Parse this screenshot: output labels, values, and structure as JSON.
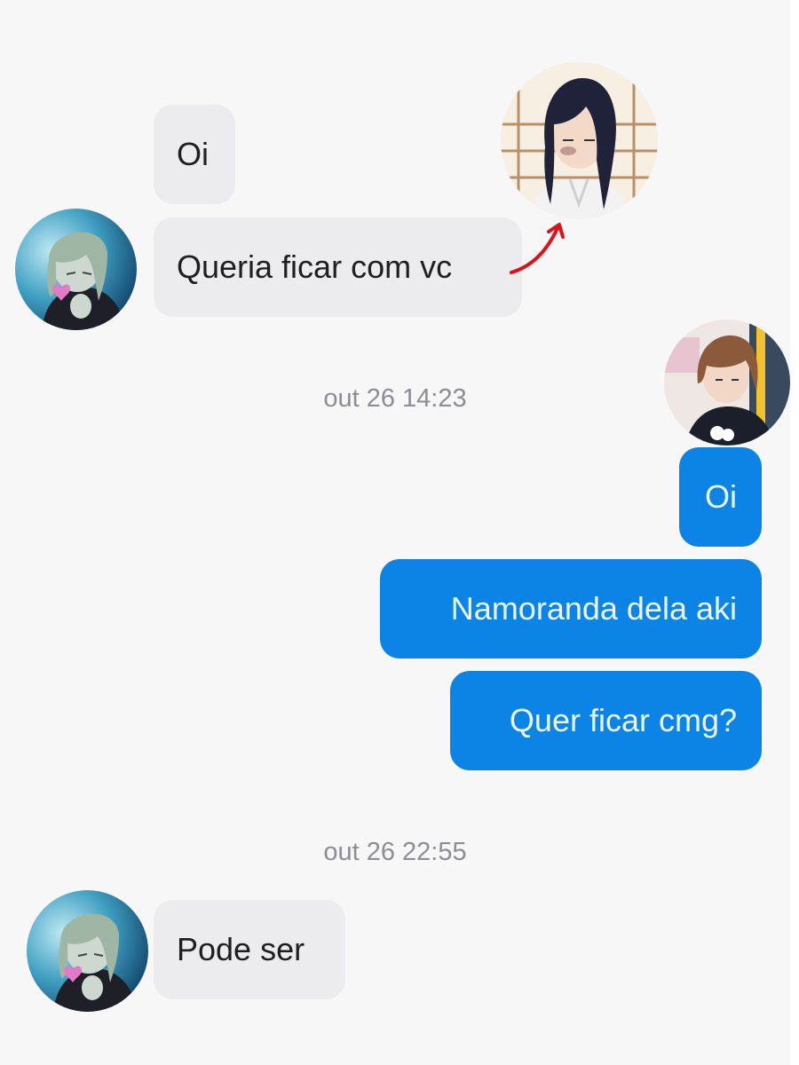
{
  "conversation": {
    "messages": [
      {
        "direction": "incoming",
        "text": "Oi"
      },
      {
        "direction": "incoming",
        "text": "Queria ficar com vc"
      },
      {
        "direction": "outgoing",
        "text": "Oi"
      },
      {
        "direction": "outgoing",
        "text": "Namoranda dela aki"
      },
      {
        "direction": "outgoing",
        "text": "Quer ficar cmg?"
      },
      {
        "direction": "incoming",
        "text": "Pode ser"
      }
    ],
    "timestamps": [
      "out 26 14:23",
      "out 26 22:55"
    ]
  },
  "avatars": {
    "incoming_contact": "anime-character-green-hair-avatar",
    "referenced_person": "anime-character-dark-hair-avatar",
    "outgoing_user": "anime-character-brown-hair-avatar"
  },
  "colors": {
    "incoming_bubble": "#ececef",
    "outgoing_bubble": "#0b84e6",
    "outgoing_text": "#e9f6ff",
    "timestamp_text": "#8d8d93",
    "arrow": "#d9121c",
    "background": "#f7f7f8"
  }
}
